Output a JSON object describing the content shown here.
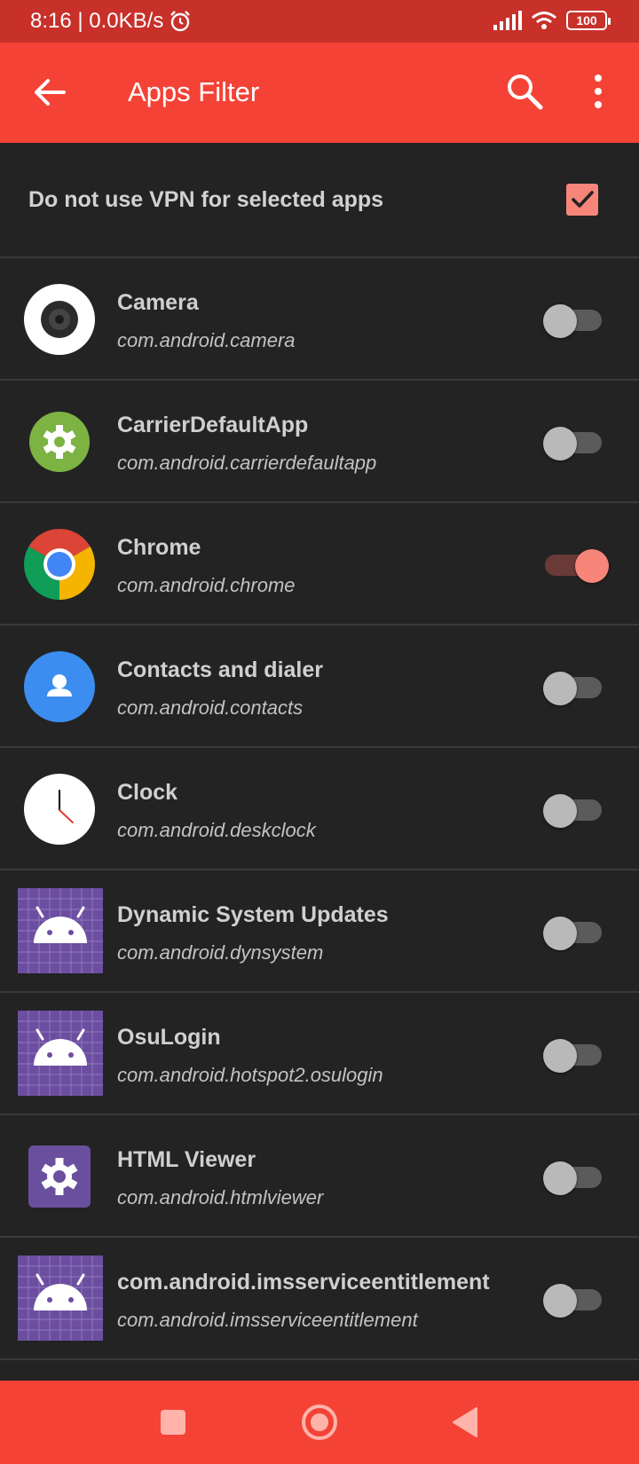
{
  "status_bar": {
    "time_speed": "8:16 | 0.0KB/s",
    "battery": "100",
    "icons": [
      "alarm-icon",
      "signal-icon",
      "wifi-icon",
      "battery-icon"
    ]
  },
  "app_bar": {
    "title": "Apps Filter",
    "icons": [
      "back-arrow-icon",
      "search-icon",
      "more-vert-icon"
    ]
  },
  "settings": {
    "exclude_label": "Do not use VPN for selected apps",
    "exclude_checked": true
  },
  "apps": [
    {
      "name": "Camera",
      "package": "com.android.camera",
      "enabled": false,
      "icon": "camera-icon"
    },
    {
      "name": "CarrierDefaultApp",
      "package": "com.android.carrierdefaultapp",
      "enabled": false,
      "icon": "settings-gear-icon"
    },
    {
      "name": "Chrome",
      "package": "com.android.chrome",
      "enabled": true,
      "icon": "chrome-icon"
    },
    {
      "name": "Contacts and dialer",
      "package": "com.android.contacts",
      "enabled": false,
      "icon": "contacts-icon"
    },
    {
      "name": "Clock",
      "package": "com.android.deskclock",
      "enabled": false,
      "icon": "clock-icon"
    },
    {
      "name": "Dynamic System Updates",
      "package": "com.android.dynsystem",
      "enabled": false,
      "icon": "android-icon"
    },
    {
      "name": "OsuLogin",
      "package": "com.android.hotspot2.osulogin",
      "enabled": false,
      "icon": "android-icon"
    },
    {
      "name": "HTML Viewer",
      "package": "com.android.htmlviewer",
      "enabled": false,
      "icon": "settings-gear-icon"
    },
    {
      "name": "com.android.imsserviceentitlement",
      "package": "com.android.imsserviceentitlement",
      "enabled": false,
      "icon": "android-icon"
    }
  ],
  "nav_bar": {
    "icons": [
      "recents-square-icon",
      "home-circle-icon",
      "back-triangle-icon"
    ]
  },
  "colors": {
    "accent": "#f44336",
    "status_bar": "#c8302a",
    "background": "#232323",
    "switch_on": "#f7857a"
  }
}
